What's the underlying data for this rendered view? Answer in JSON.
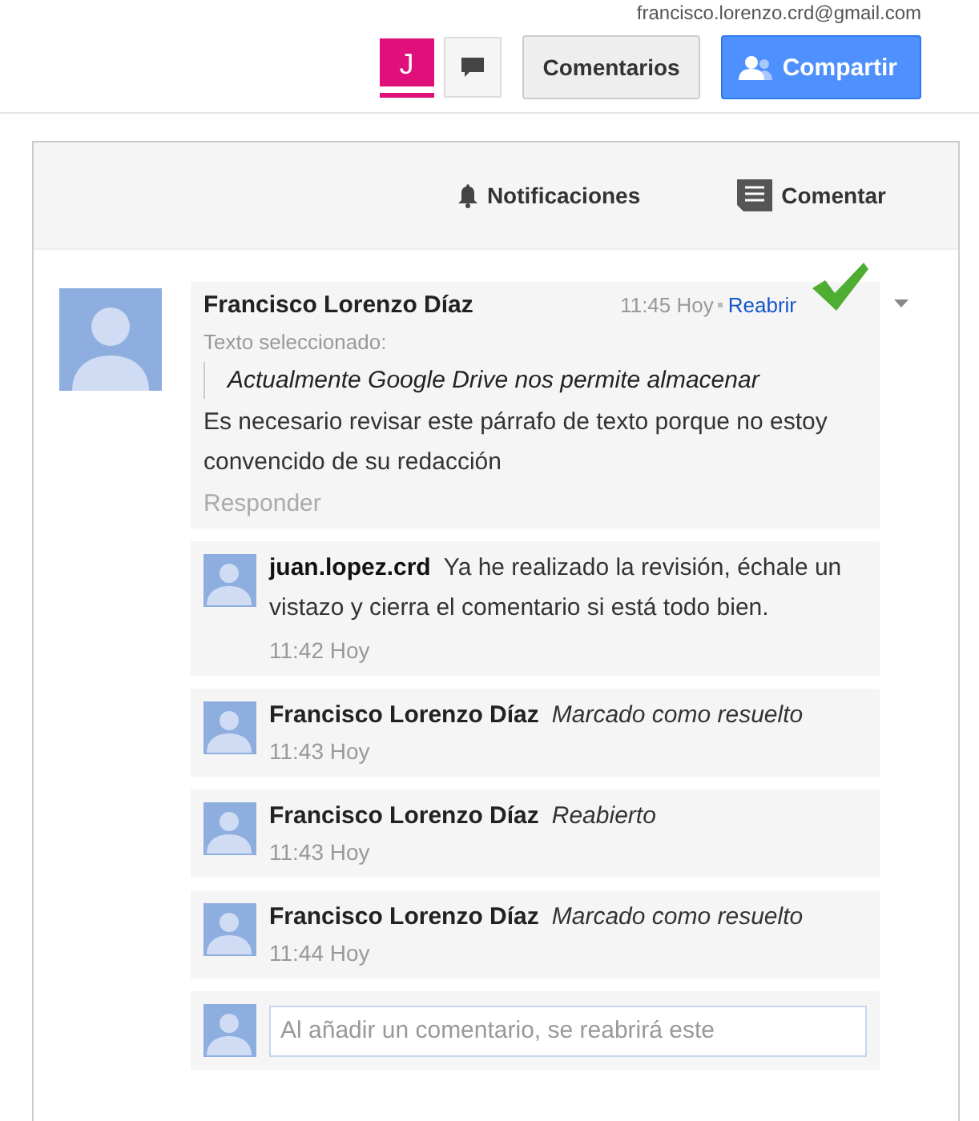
{
  "account_email": "francisco.lorenzo.crd@gmail.com",
  "toolbar": {
    "avatar_letter": "J",
    "comments_button": "Comentarios",
    "share_button": "Compartir"
  },
  "panel_header": {
    "notifications": "Notificaciones",
    "comment": "Comentar"
  },
  "thread": {
    "author": "Francisco Lorenzo Díaz",
    "time": "11:45 Hoy",
    "reopen_link": "Reabrir",
    "resolved": true,
    "selected_label": "Texto seleccionado:",
    "quote": "Actualmente Google Drive nos permite almacenar",
    "body": "Es necesario revisar este párrafo de texto porque no estoy convencido de su redacción",
    "reply_link": "Responder"
  },
  "replies": [
    {
      "kind": "comment",
      "author": "juan.lopez.crd",
      "text": "Ya he realizado la revisión, échale un vistazo y cierra el comentario si está todo bien.",
      "time": "11:42 Hoy"
    },
    {
      "kind": "status",
      "author": "Francisco Lorenzo Díaz",
      "text": "Marcado como resuelto",
      "time": "11:43 Hoy"
    },
    {
      "kind": "status",
      "author": "Francisco Lorenzo Díaz",
      "text": "Reabierto",
      "time": "11:43 Hoy"
    },
    {
      "kind": "status",
      "author": "Francisco Lorenzo Díaz",
      "text": "Marcado como resuelto",
      "time": "11:44 Hoy"
    }
  ],
  "reply_field": {
    "placeholder": "Al añadir un comentario, se reabrirá este"
  }
}
